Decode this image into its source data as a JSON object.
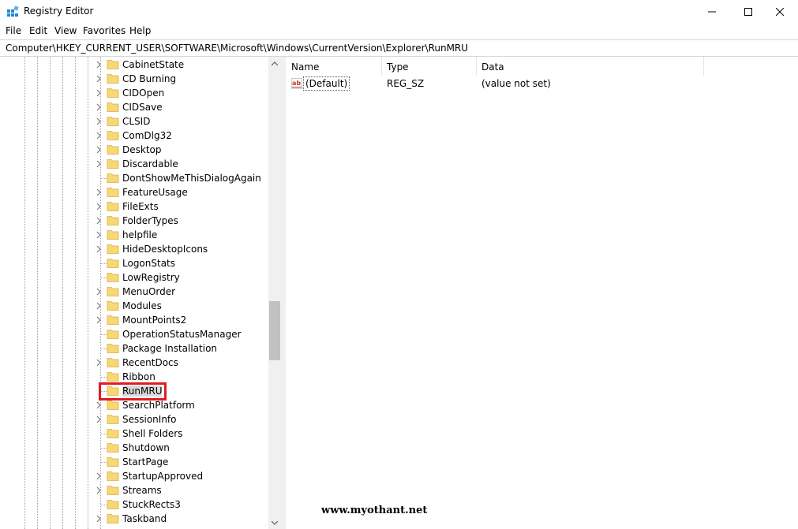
{
  "window": {
    "title": "Registry Editor",
    "minimize_icon": "minimize-icon",
    "maximize_icon": "maximize-icon",
    "close_icon": "close-icon"
  },
  "menu": [
    "File",
    "Edit",
    "View",
    "Favorites",
    "Help"
  ],
  "address": "Computer\\HKEY_CURRENT_USER\\SOFTWARE\\Microsoft\\Windows\\CurrentVersion\\Explorer\\RunMRU",
  "tree": {
    "selected": "RunMRU",
    "items": [
      {
        "label": "CabinetState",
        "expandable": true
      },
      {
        "label": "CD Burning",
        "expandable": true
      },
      {
        "label": "CIDOpen",
        "expandable": true
      },
      {
        "label": "CIDSave",
        "expandable": true
      },
      {
        "label": "CLSID",
        "expandable": true
      },
      {
        "label": "ComDlg32",
        "expandable": true
      },
      {
        "label": "Desktop",
        "expandable": true
      },
      {
        "label": "Discardable",
        "expandable": true
      },
      {
        "label": "DontShowMeThisDialogAgain",
        "expandable": false
      },
      {
        "label": "FeatureUsage",
        "expandable": true
      },
      {
        "label": "FileExts",
        "expandable": true
      },
      {
        "label": "FolderTypes",
        "expandable": true
      },
      {
        "label": "helpfile",
        "expandable": true
      },
      {
        "label": "HideDesktopIcons",
        "expandable": true
      },
      {
        "label": "LogonStats",
        "expandable": false
      },
      {
        "label": "LowRegistry",
        "expandable": false
      },
      {
        "label": "MenuOrder",
        "expandable": true
      },
      {
        "label": "Modules",
        "expandable": true
      },
      {
        "label": "MountPoints2",
        "expandable": true
      },
      {
        "label": "OperationStatusManager",
        "expandable": false
      },
      {
        "label": "Package Installation",
        "expandable": false
      },
      {
        "label": "RecentDocs",
        "expandable": true
      },
      {
        "label": "Ribbon",
        "expandable": false
      },
      {
        "label": "RunMRU",
        "expandable": false
      },
      {
        "label": "SearchPlatform",
        "expandable": true
      },
      {
        "label": "SessionInfo",
        "expandable": true
      },
      {
        "label": "Shell Folders",
        "expandable": false
      },
      {
        "label": "Shutdown",
        "expandable": false
      },
      {
        "label": "StartPage",
        "expandable": false
      },
      {
        "label": "StartupApproved",
        "expandable": true
      },
      {
        "label": "Streams",
        "expandable": true
      },
      {
        "label": "StuckRects3",
        "expandable": false
      },
      {
        "label": "Taskband",
        "expandable": true
      }
    ]
  },
  "list": {
    "columns": [
      "Name",
      "Type",
      "Data"
    ],
    "rows": [
      {
        "icon": "string-value-icon",
        "name": "(Default)",
        "type": "REG_SZ",
        "data": "(value not set)"
      }
    ]
  },
  "watermark": "www.myothant.net",
  "colors": {
    "highlight": "#e01b24",
    "folder": "#f8d775",
    "folder_edge": "#dcae3c"
  }
}
